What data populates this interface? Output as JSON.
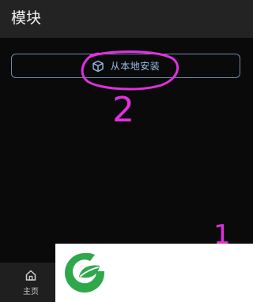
{
  "header": {
    "title": "模块"
  },
  "install": {
    "label": "从本地安装",
    "icon": "cube-icon"
  },
  "annotations": {
    "label_1": "1",
    "label_2": "2",
    "color": "#e030e0"
  },
  "nav": {
    "home_label": "主页",
    "home_icon": "home-icon"
  },
  "colors": {
    "accent": "#9bbde6",
    "border": "#6a8bb3",
    "background": "#0a0a0a",
    "topbar": "#232323",
    "logo_green": "#2fa84a"
  }
}
